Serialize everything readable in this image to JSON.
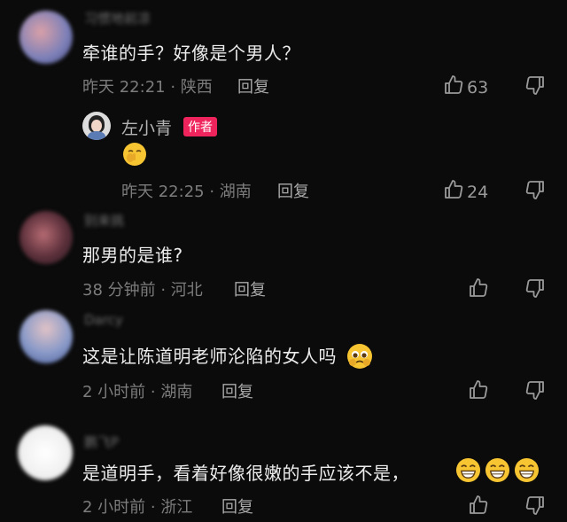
{
  "comments": [
    {
      "username": "习惯地前凉",
      "text": "牵谁的手？好像是个男人？",
      "meta": "昨天 22:21 · 陕西",
      "reply_label": "回复",
      "likes": "63"
    },
    {
      "username": "左小青",
      "author_badge": "作者",
      "meta": "昨天 22:25 · 湖南",
      "reply_label": "回复",
      "likes": "24"
    },
    {
      "username": "别来挑",
      "text": "那男的是谁?",
      "meta": "38 分钟前 · 河北",
      "reply_label": "回复"
    },
    {
      "username": "Darcy",
      "text": "这是让陈道明老师沦陷的女人吗",
      "meta": "2 小时前 · 湖南",
      "reply_label": "回复"
    },
    {
      "username": "鹏飞P",
      "text": "是道明手，看着好像很嫩的手应该不是，",
      "meta": "2 小时前 · 浙江",
      "reply_label": "回复"
    }
  ],
  "colors": {
    "background": "#0b0b0b",
    "badge": "#f0245c",
    "emoji": "#f7c531"
  },
  "icons": [
    "thumbs-up-icon",
    "thumbs-down-icon",
    "shush-face-emoji",
    "pleading-face-emoji",
    "grinning-face-emoji"
  ]
}
